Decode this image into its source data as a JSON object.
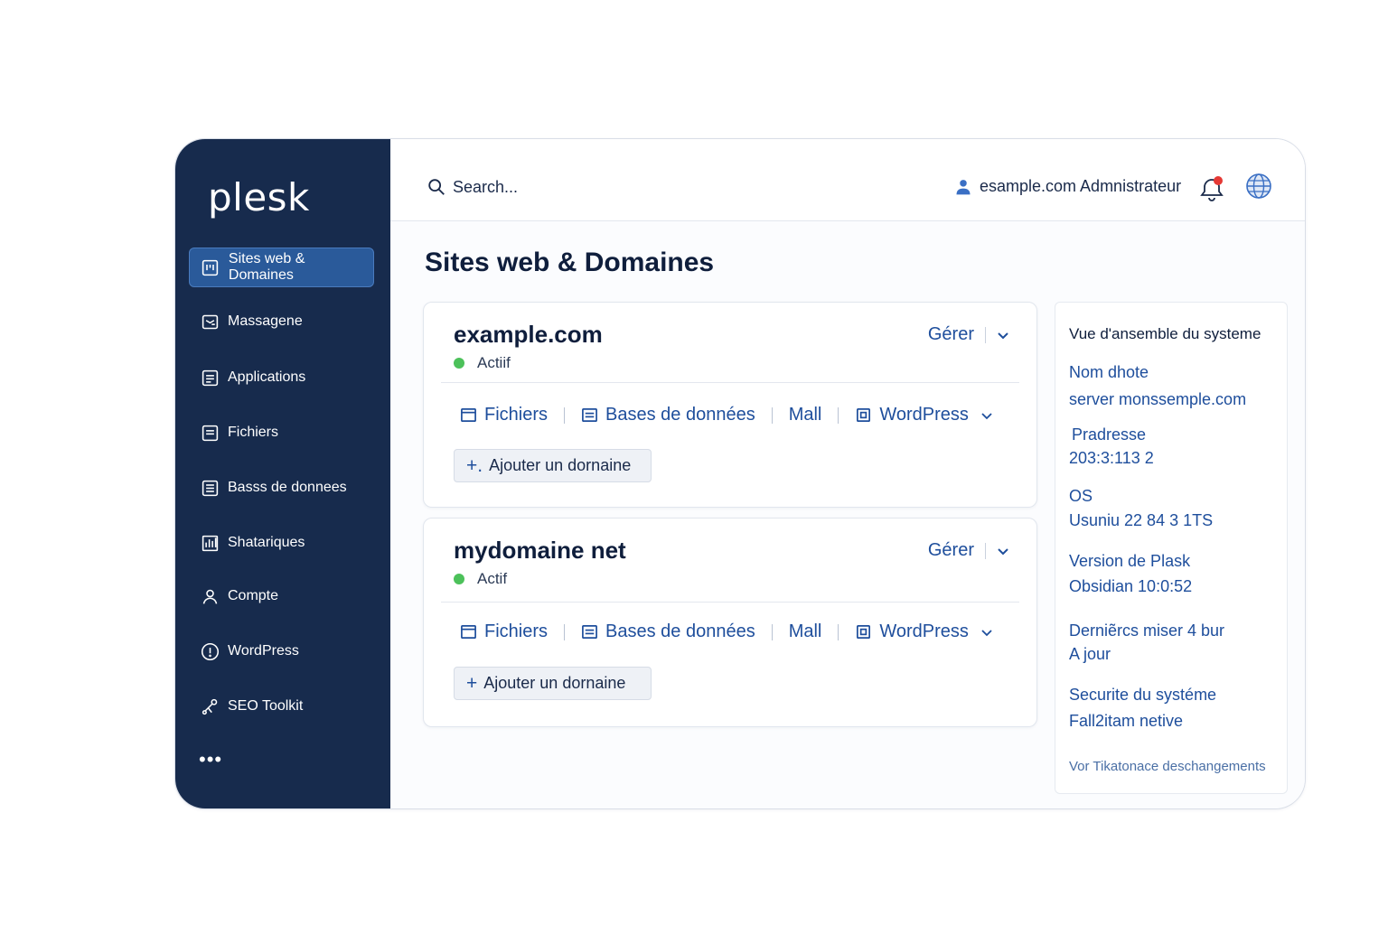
{
  "app": {
    "logo": "plesk"
  },
  "sidebar": {
    "items": [
      {
        "label": "Sites web & Domaines",
        "icon": "dashboard-icon",
        "active": true
      },
      {
        "label": "Massagene",
        "icon": "mail-icon",
        "active": false
      },
      {
        "label": "Applications",
        "icon": "apps-icon",
        "active": false
      },
      {
        "label": "Fichiers",
        "icon": "files-icon",
        "active": false
      },
      {
        "label": "Basss de donnees",
        "icon": "database-icon",
        "active": false
      },
      {
        "label": "Shatariques",
        "icon": "stats-icon",
        "active": false
      },
      {
        "label": "Compte",
        "icon": "user-icon",
        "active": false
      },
      {
        "label": "WordPress",
        "icon": "wordpress-icon",
        "active": false
      },
      {
        "label": "SEO Toolkit",
        "icon": "seo-icon",
        "active": false
      }
    ],
    "more": "•••"
  },
  "topbar": {
    "search_placeholder": "Search...",
    "user_label": "esample.com Admnistrateur",
    "notification_dot_color": "#e53935"
  },
  "page": {
    "title": "Sites web & Domaines"
  },
  "domains": [
    {
      "name": "example.com",
      "status": "Actiif",
      "manage": "Gérer",
      "links": {
        "files": "Fichiers",
        "databases": "Bases de données",
        "mail": "Mall",
        "wordpress": "WordPress"
      },
      "add_label": "Ajouter un dornaine",
      "add_prefix": "+."
    },
    {
      "name": "mydomaine net",
      "status": "Actif",
      "manage": "Gérer",
      "links": {
        "files": "Fichiers",
        "databases": "Bases de données",
        "mail": "Mall",
        "wordpress": "WordPress"
      },
      "add_label": "Ajouter un dornaine",
      "add_prefix": "+"
    }
  ],
  "overview": {
    "title": "Vue d'ansemble du systeme",
    "hostname_label": "Nom dhote",
    "hostname_value": "server monssemple.com",
    "ip_label": "Pradresse",
    "ip_value": "203:3:113 2",
    "os_label": "OS",
    "os_value": "Usuniu 22 84 3 1TS",
    "version_label": "Version de Plask",
    "version_value": "Obsidian 10:0:52",
    "updates_label": "Derniẽrcs miser 4 bur",
    "updates_value": "A jour",
    "security_label": "Securite du systéme",
    "security_value": "Fall2itam netive",
    "changelog_link": "Vor Tikatonace deschangements"
  },
  "colors": {
    "sidebar_bg": "#172b4d",
    "active_item_bg": "#2a5a9a",
    "link_blue": "#1e4e9c",
    "status_green": "#4cc15a"
  }
}
